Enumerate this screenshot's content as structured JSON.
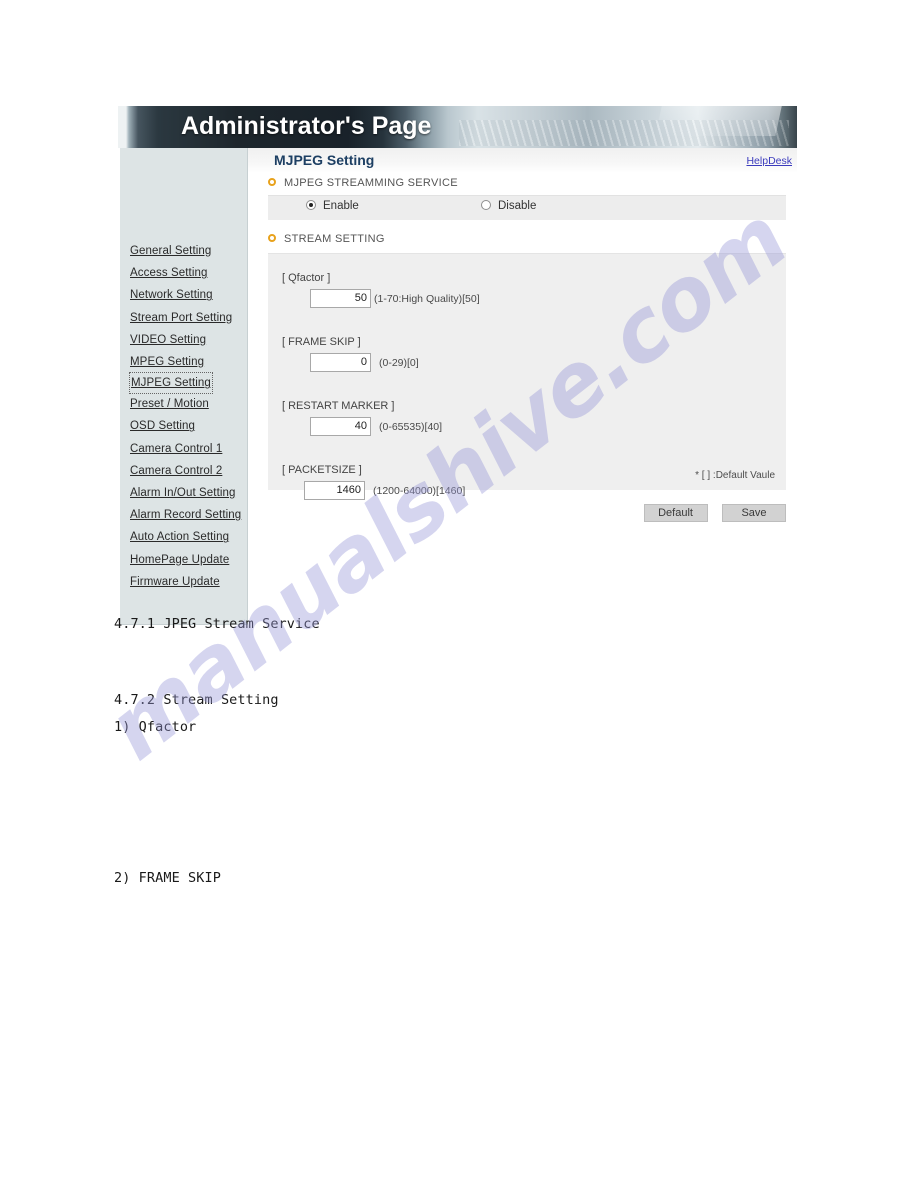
{
  "banner": {
    "title": "Administrator's Page"
  },
  "content_header": {
    "page_title": "MJPEG Setting",
    "helpdesk_label": "HelpDesk"
  },
  "sidebar": {
    "items": [
      {
        "label": "General Setting",
        "selected": false
      },
      {
        "label": "Access Setting",
        "selected": false
      },
      {
        "label": "Network Setting",
        "selected": false
      },
      {
        "label": "Stream Port Setting",
        "selected": false
      },
      {
        "label": "VIDEO Setting",
        "selected": false
      },
      {
        "label": "MPEG Setting",
        "selected": false
      },
      {
        "label": "MJPEG Setting",
        "selected": true
      },
      {
        "label": "Preset / Motion",
        "selected": false
      },
      {
        "label": "OSD Setting",
        "selected": false
      },
      {
        "label": "Camera Control 1",
        "selected": false
      },
      {
        "label": "Camera Control 2",
        "selected": false
      },
      {
        "label": "Alarm In/Out Setting",
        "selected": false
      },
      {
        "label": "Alarm Record Setting",
        "selected": false
      },
      {
        "label": "Auto Action Setting",
        "selected": false
      },
      {
        "label": "HomePage Update",
        "selected": false
      },
      {
        "label": "Firmware Update",
        "selected": false
      }
    ]
  },
  "streaming_service": {
    "section_title": "MJPEG STREAMMING SERVICE",
    "enable_label": "Enable",
    "disable_label": "Disable",
    "selected": "Enable"
  },
  "stream_setting": {
    "section_title": "STREAM SETTING",
    "fields": [
      {
        "label": "[ Qfactor ]",
        "value": "50",
        "hint": "(1-70:High Quality)[50]"
      },
      {
        "label": "[ FRAME SKIP ]",
        "value": "0",
        "hint": "(0-29)[0]"
      },
      {
        "label": "[ RESTART MARKER ]",
        "value": "40",
        "hint": "(0-65535)[40]"
      },
      {
        "label": "[ PACKETSIZE ]",
        "value": "1460",
        "hint": "(1200-64000)[1460]"
      }
    ],
    "default_note": "* [ ] :Default Vaule"
  },
  "buttons": {
    "default_label": "Default",
    "save_label": "Save"
  },
  "document": {
    "lines": [
      "4.7.1 JPEG Stream Service",
      "4.7.2 Stream Setting",
      "1) Qfactor",
      "2) FRAME SKIP"
    ]
  },
  "watermark": {
    "text": "manualshive.com"
  },
  "colors": {
    "accent_orange": "#e8a21c",
    "title_blue": "#1d3f63",
    "link_blue": "#3b3bbd",
    "sidebar_bg": "#dde4e5",
    "panel_bg": "#efefef"
  }
}
